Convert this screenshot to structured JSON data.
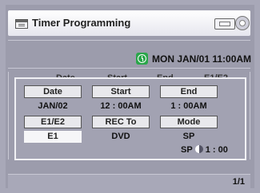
{
  "header": {
    "title": "Timer Programming",
    "icons": [
      "timer-list-icon",
      "tape-icon",
      "disc-icon"
    ]
  },
  "clock": {
    "icon": "clock-icon",
    "icon_color": "#2aa64a",
    "datetime": "MON JAN/01 11:00AM"
  },
  "list_header": {
    "columns": [
      "Date",
      "Start",
      "End",
      "E1/E2"
    ]
  },
  "dialog": {
    "date_label": "Date",
    "start_label": "Start",
    "end_label": "End",
    "date_value": "JAN/02",
    "start_value": "12 : 00AM",
    "end_value": "1 : 00AM",
    "e1e2_label": "E1/E2",
    "recto_label": "REC To",
    "mode_label": "Mode",
    "e1e2_value": "E1",
    "recto_value": "DVD",
    "mode_value": "SP",
    "remaining_mode": "SP",
    "remaining_time": "1 : 00"
  },
  "footer": {
    "page": "1/1"
  }
}
